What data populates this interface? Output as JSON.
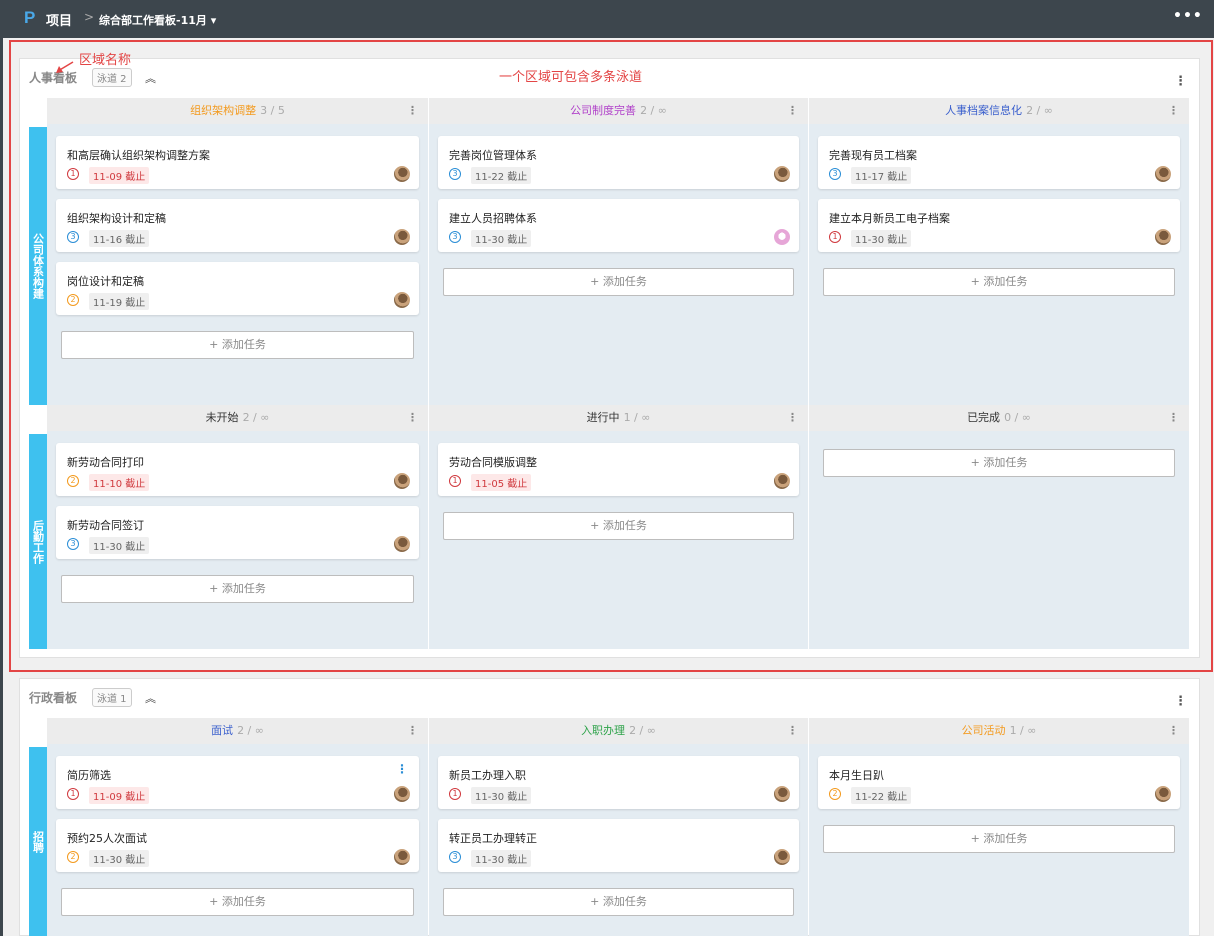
{
  "topbar": {
    "logo": "P",
    "project": "项目",
    "separator": ">",
    "board": "综合部工作看板-11月 ▾",
    "menu": "•••"
  },
  "annotations": {
    "area_name": "区域名称",
    "multi_lane": "一个区域可包含多条泳道"
  },
  "add_task_label": "+ 添加任务",
  "colors": {
    "orange": "#f39a1e",
    "purple": "#b03fc9",
    "blue": "#3a5fcd",
    "green": "#2ea34a",
    "black": "#333333",
    "lane": "#3ec1ef",
    "annotation": "#e34545"
  },
  "areas": [
    {
      "title": "人事看板",
      "badge": "泳道 2",
      "collapse": "︽",
      "menu": "⋮",
      "lanes": [
        {
          "name": "公司体系构建",
          "columns": [
            {
              "title": "组织架构调整",
              "count": "3 / 5",
              "color": "orange",
              "menu": "⋮",
              "cards": [
                {
                  "title": "和高层确认组织架构调整方案",
                  "priority": "1",
                  "due": "11-09 截止",
                  "overdue": true
                },
                {
                  "title": "组织架构设计和定稿",
                  "priority": "3",
                  "due": "11-16 截止",
                  "overdue": false
                },
                {
                  "title": "岗位设计和定稿",
                  "priority": "2",
                  "due": "11-19 截止",
                  "overdue": false
                }
              ]
            },
            {
              "title": "公司制度完善",
              "count": "2 / ∞",
              "color": "purple",
              "menu": "⋮",
              "cards": [
                {
                  "title": "完善岗位管理体系",
                  "priority": "3",
                  "due": "11-22 截止",
                  "overdue": false
                },
                {
                  "title": "建立人员招聘体系",
                  "priority": "3",
                  "due": "11-30 截止",
                  "overdue": false
                }
              ]
            },
            {
              "title": "人事档案信息化",
              "count": "2 / ∞",
              "color": "blue",
              "menu": "⋮",
              "cards": [
                {
                  "title": "完善现有员工档案",
                  "priority": "3",
                  "due": "11-17 截止",
                  "overdue": false
                },
                {
                  "title": "建立本月新员工电子档案",
                  "priority": "1",
                  "due": "11-30 截止",
                  "overdue": false
                }
              ]
            }
          ]
        },
        {
          "name": "后勤工作",
          "columns": [
            {
              "title": "未开始",
              "count": "2 / ∞",
              "color": "black",
              "menu": "⋮",
              "cards": [
                {
                  "title": "新劳动合同打印",
                  "priority": "2",
                  "due": "11-10 截止",
                  "overdue": true
                },
                {
                  "title": "新劳动合同签订",
                  "priority": "3",
                  "due": "11-30 截止",
                  "overdue": false
                }
              ]
            },
            {
              "title": "进行中",
              "count": "1 / ∞",
              "color": "black",
              "menu": "⋮",
              "cards": [
                {
                  "title": "劳动合同模版调整",
                  "priority": "1",
                  "due": "11-05 截止",
                  "overdue": true
                }
              ]
            },
            {
              "title": "已完成",
              "count": "0 / ∞",
              "color": "black",
              "menu": "⋮",
              "cards": []
            }
          ]
        }
      ]
    },
    {
      "title": "行政看板",
      "badge": "泳道 1",
      "collapse": "︽",
      "menu": "⋮",
      "lanes": [
        {
          "name": "招聘",
          "columns": [
            {
              "title": "面试",
              "count": "2 / ∞",
              "color": "blue",
              "menu": "⋮",
              "cards": [
                {
                  "title": "简历筛选",
                  "priority": "1",
                  "due": "11-09 截止",
                  "overdue": true
                },
                {
                  "title": "预约25人次面试",
                  "priority": "2",
                  "due": "11-30 截止",
                  "overdue": false
                }
              ]
            },
            {
              "title": "入职办理",
              "count": "2 / ∞",
              "color": "green",
              "menu": "⋮",
              "cards": [
                {
                  "title": "新员工办理入职",
                  "priority": "1",
                  "due": "11-30 截止",
                  "overdue": false
                },
                {
                  "title": "转正员工办理转正",
                  "priority": "3",
                  "due": "11-30 截止",
                  "overdue": false
                }
              ]
            },
            {
              "title": "公司活动",
              "count": "1 / ∞",
              "color": "orange",
              "menu": "⋮",
              "cards": [
                {
                  "title": "本月生日趴",
                  "priority": "2",
                  "due": "11-22 截止",
                  "overdue": false
                }
              ]
            }
          ]
        }
      ]
    }
  ]
}
